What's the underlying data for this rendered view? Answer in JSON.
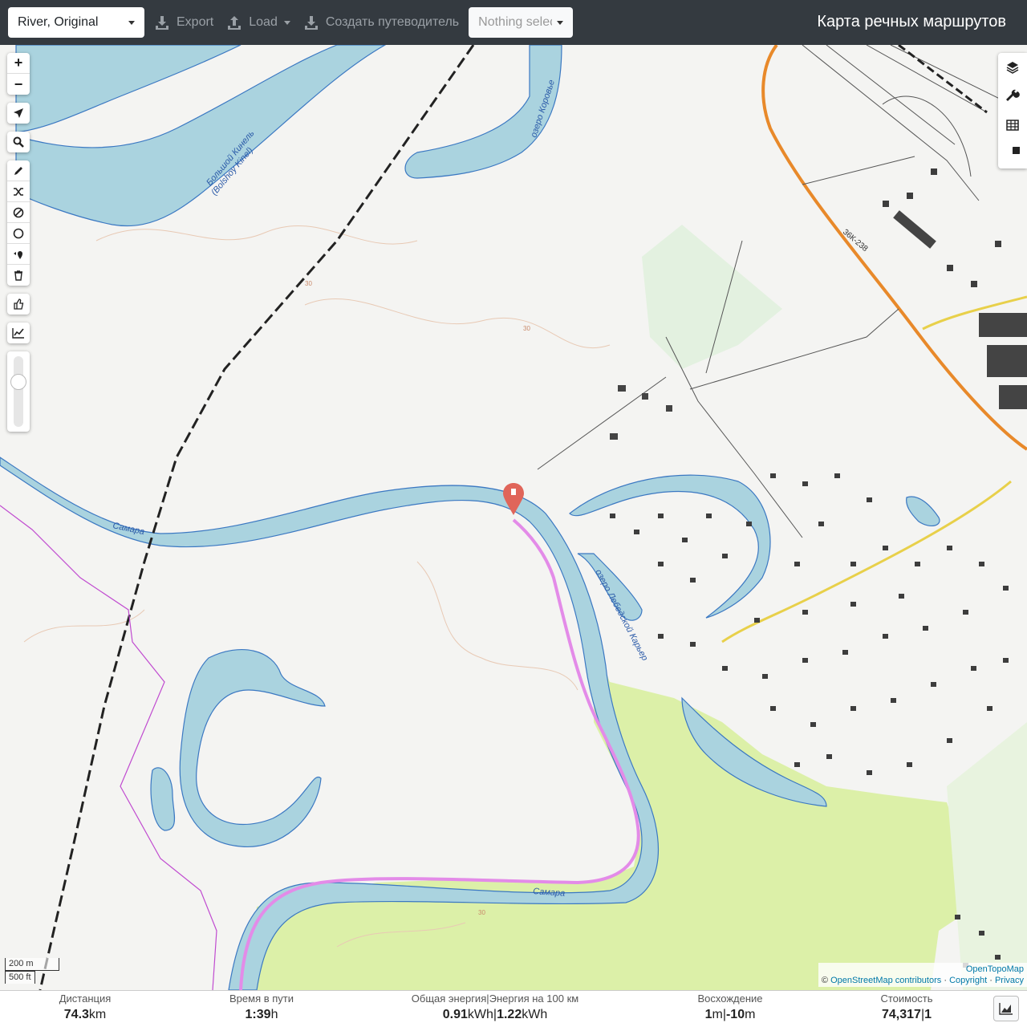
{
  "toolbar": {
    "profile_value": "River, Original",
    "export_label": "Export",
    "load_label": "Load",
    "guide_label": "Создать путеводитель",
    "nothing_selected": "Nothing selected",
    "app_title": "Карта речных маршрутов"
  },
  "map": {
    "labels": {
      "big_kinel": "Большой Кинель",
      "big_kinel_latin": "(Bolshoy Kinel)",
      "samara_1": "Самара",
      "samara_2": "Самара",
      "lake_korovye": "озеро Коровье",
      "lake_lebedsky": "озеро Лебедской Карьер",
      "road_ref": "36К-238",
      "contour_30": "30"
    },
    "scale_metric": "200 m",
    "scale_imperial": "500 ft",
    "attribution": {
      "prefix": "©",
      "osm": "OpenStreetMap contributors",
      "copyright": "Copyright",
      "privacy": "Privacy",
      "tiles": "OpenTopoMap",
      "sep": "·"
    },
    "colors": {
      "water": "#aad3df",
      "water_edge": "#3b78c2",
      "route": "#e38be8",
      "forest": "#dcf0a8",
      "railway": "#222222",
      "road": "#e8892a",
      "boundary": "#c04bd0",
      "marker": "#e0655a"
    }
  },
  "controls": {
    "left_icons": [
      "zoom-in-icon",
      "zoom-out-icon",
      "locate-icon",
      "search-icon",
      "draw-icon",
      "shuffle-icon",
      "no-go-icon",
      "circle-icon",
      "poi-icon",
      "trash-icon",
      "thumb-up-icon",
      "elevation-icon"
    ],
    "zoom_in": "+",
    "zoom_out": "−",
    "right_icons": [
      "layers-icon",
      "wrench-icon",
      "table-icon",
      "pie-chart-icon"
    ]
  },
  "stats": {
    "distance_label": "Дистанция",
    "distance_value": "74.3",
    "distance_unit": "km",
    "time_label": "Время в пути",
    "time_value": "1:39",
    "time_unit": "h",
    "energy_label": "Общая энергия|Энергия на 100 км",
    "energy_value_1": "0.91",
    "energy_unit_1": "kWh",
    "energy_value_2": "1.22",
    "energy_unit_2": "kWh",
    "ascent_label": "Восхождение",
    "ascent_value_1": "1",
    "ascent_unit_1": "m",
    "ascent_value_2": "-10",
    "ascent_unit_2": "m",
    "cost_label": "Стоимость",
    "cost_value_1": "74,317",
    "cost_value_2": "1",
    "sep": "|"
  }
}
